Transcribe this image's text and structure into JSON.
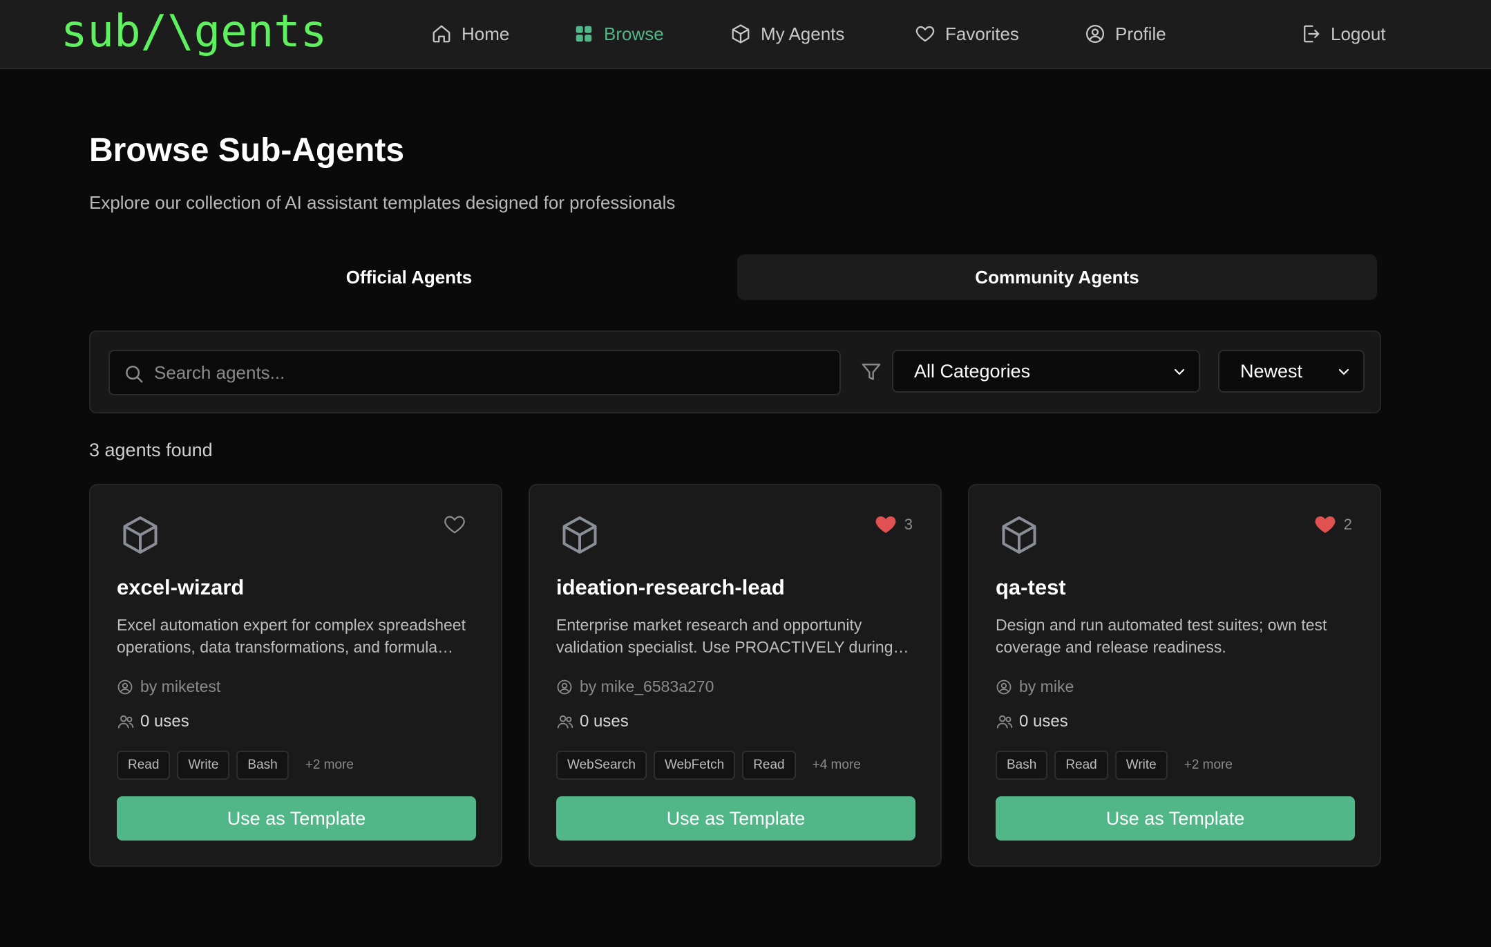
{
  "logo": "sub/\\gents",
  "nav": {
    "home": "Home",
    "browse": "Browse",
    "my_agents": "My Agents",
    "favorites": "Favorites",
    "profile": "Profile",
    "logout": "Logout"
  },
  "colors": {
    "accent": "#52b788",
    "logo": "#5ef05e",
    "heart": "#e05252"
  },
  "page": {
    "title": "Browse Sub-Agents",
    "subtitle": "Explore our collection of AI assistant templates designed for professionals"
  },
  "tabs": {
    "official": "Official Agents",
    "community": "Community Agents"
  },
  "filters": {
    "search_placeholder": "Search agents...",
    "search_value": "",
    "category": "All Categories",
    "sort": "Newest"
  },
  "result_count": "3 agents found",
  "cards": [
    {
      "name": "excel-wizard",
      "description": "Excel automation expert for complex spreadsheet operations, data transformations, and formula design.",
      "author": "by miketest",
      "uses": "0 uses",
      "favorited": false,
      "fav_count": "",
      "tags": [
        "Read",
        "Write",
        "Bash"
      ],
      "more": "+2 more",
      "button": "Use as Template"
    },
    {
      "name": "ideation-research-lead",
      "description": "Enterprise market research and opportunity validation specialist. Use PROACTIVELY during ideation phases.",
      "author": "by mike_6583a270",
      "uses": "0 uses",
      "favorited": true,
      "fav_count": "3",
      "tags": [
        "WebSearch",
        "WebFetch",
        "Read"
      ],
      "more": "+4 more",
      "button": "Use as Template"
    },
    {
      "name": "qa-test",
      "description": "Design and run automated test suites; own test coverage and release readiness.",
      "author": "by mike",
      "uses": "0 uses",
      "favorited": true,
      "fav_count": "2",
      "tags": [
        "Bash",
        "Read",
        "Write"
      ],
      "more": "+2 more",
      "button": "Use as Template"
    }
  ]
}
